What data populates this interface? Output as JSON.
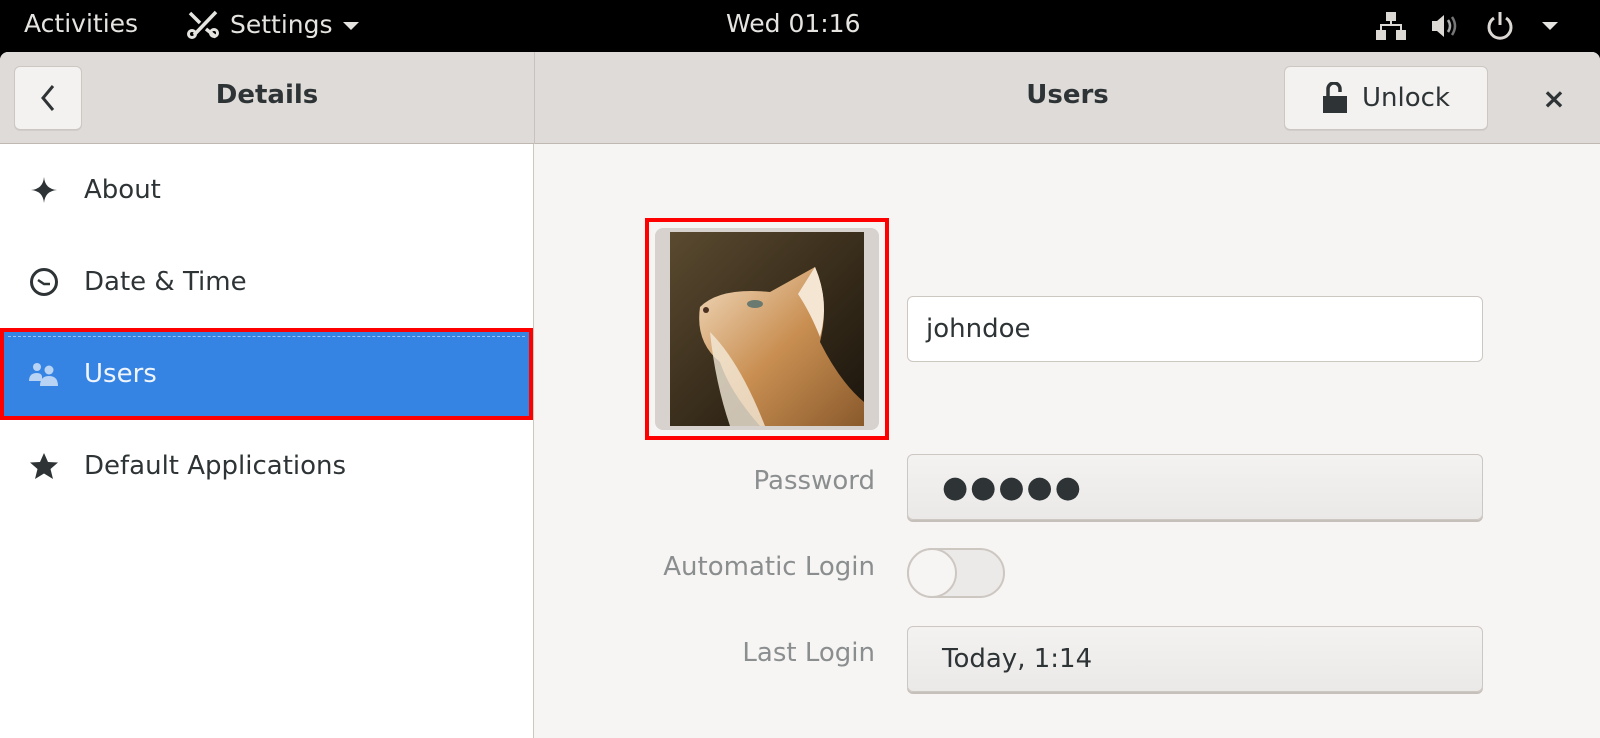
{
  "topbar": {
    "activities": "Activities",
    "app_menu": "Settings",
    "clock": "Wed 01:16",
    "tray_icons": [
      "network-wired-icon",
      "volume-icon",
      "power-icon"
    ]
  },
  "headerbar": {
    "left_title": "Details",
    "right_title": "Users",
    "unlock_label": "Unlock",
    "close_glyph": "×"
  },
  "sidebar": {
    "items": [
      {
        "label": "About",
        "icon": "sparkle-icon",
        "selected": false
      },
      {
        "label": "Date & Time",
        "icon": "clock-icon",
        "selected": false
      },
      {
        "label": "Users",
        "icon": "users-icon",
        "selected": true
      },
      {
        "label": "Default Applications",
        "icon": "star-icon",
        "selected": false
      }
    ]
  },
  "user": {
    "username": "johndoe",
    "avatar": "cat-photo",
    "password_label": "Password",
    "password_value": "●●●●●",
    "autologin_label": "Automatic Login",
    "autologin_on": false,
    "last_login_label": "Last Login",
    "last_login_value": "Today,  1:14"
  },
  "colors": {
    "accent": "#3584e4",
    "highlight": "#ff0000"
  }
}
